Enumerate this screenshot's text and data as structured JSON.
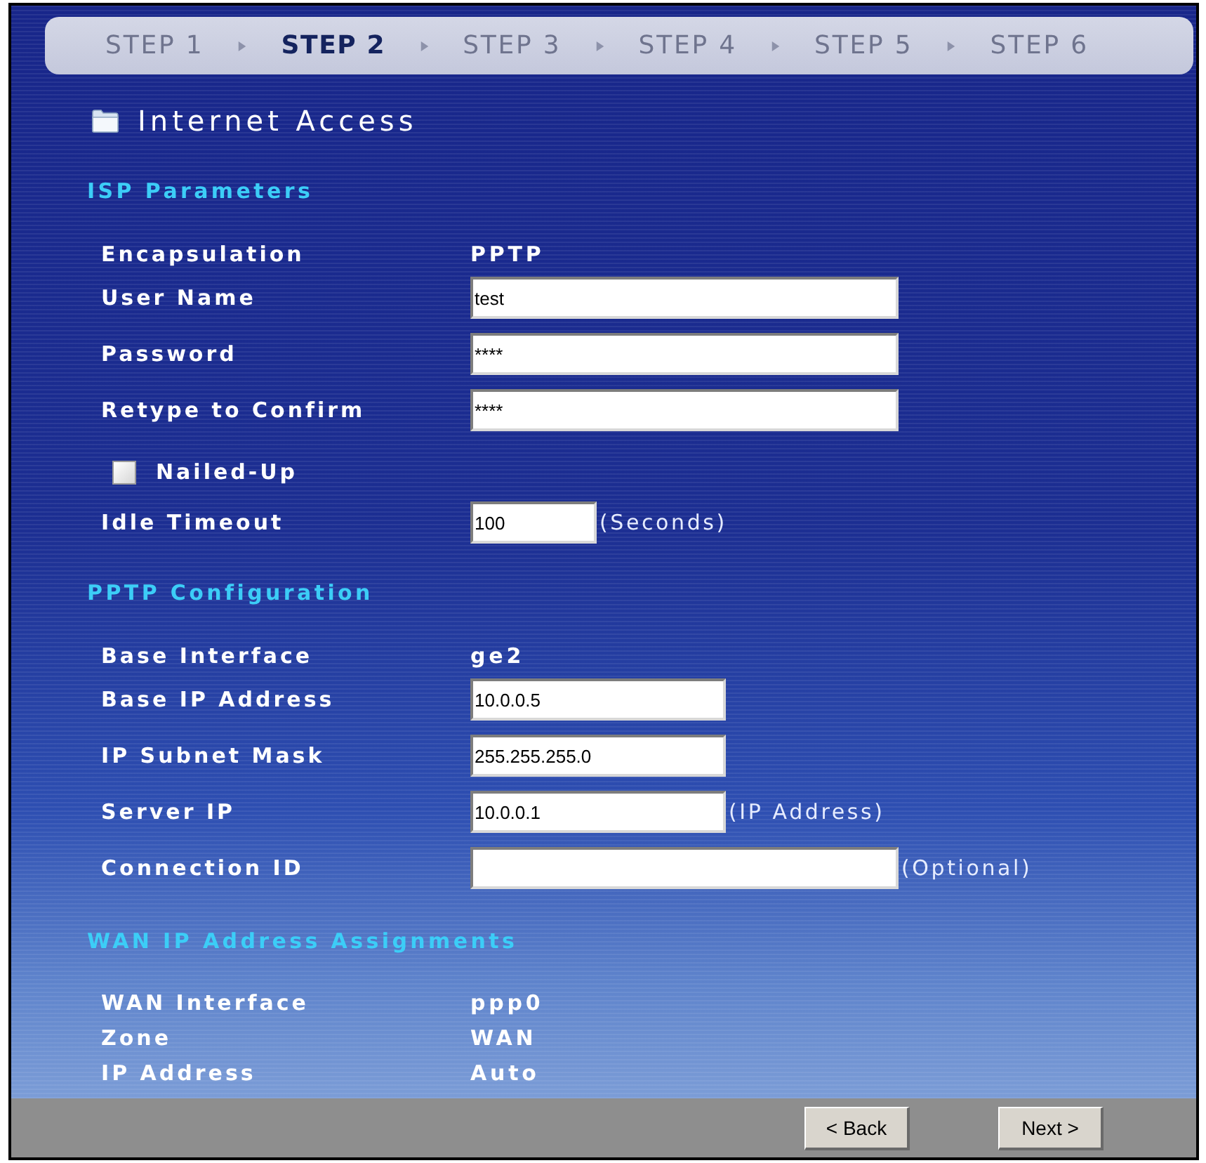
{
  "steps": [
    {
      "label": "STEP 1",
      "selected": false
    },
    {
      "label": "STEP 2",
      "selected": true
    },
    {
      "label": "STEP 3",
      "selected": false
    },
    {
      "label": "STEP 4",
      "selected": false
    },
    {
      "label": "STEP 5",
      "selected": false
    },
    {
      "label": "STEP 6",
      "selected": false
    }
  ],
  "page_title": "Internet Access",
  "sections": [
    {
      "title": "ISP Parameters",
      "rows": [
        {
          "kind": "text",
          "label": "Encapsulation",
          "value": "PPTP"
        },
        {
          "kind": "input",
          "label": "User Name",
          "value": "test"
        },
        {
          "kind": "input",
          "label": "Password",
          "value": "****"
        },
        {
          "kind": "input",
          "label": "Retype to Confirm",
          "value": "****"
        },
        {
          "kind": "checkbox",
          "label": "Nailed-Up",
          "checked": false
        },
        {
          "kind": "input",
          "label": "Idle Timeout",
          "value": "100",
          "hint": "(Seconds)"
        }
      ]
    },
    {
      "title": "PPTP Configuration",
      "rows": [
        {
          "kind": "text",
          "label": "Base Interface",
          "value": "ge2"
        },
        {
          "kind": "input",
          "label": "Base IP Address",
          "value": "10.0.0.5"
        },
        {
          "kind": "input",
          "label": "IP Subnet Mask",
          "value": "255.255.255.0"
        },
        {
          "kind": "input",
          "label": "Server IP",
          "value": "10.0.0.1",
          "hint": "(IP Address)"
        },
        {
          "kind": "input",
          "label": "Connection ID",
          "hint": "(Optional)"
        }
      ]
    },
    {
      "title": "WAN IP Address Assignments",
      "rows": [
        {
          "kind": "text",
          "label": "WAN Interface",
          "value": "ppp0"
        },
        {
          "kind": "text",
          "label": "Zone",
          "value": "WAN"
        },
        {
          "kind": "text",
          "label": "IP Address",
          "value": "Auto"
        }
      ]
    }
  ],
  "buttons": [
    {
      "label": "< Back"
    },
    {
      "label": "Next >"
    }
  ]
}
